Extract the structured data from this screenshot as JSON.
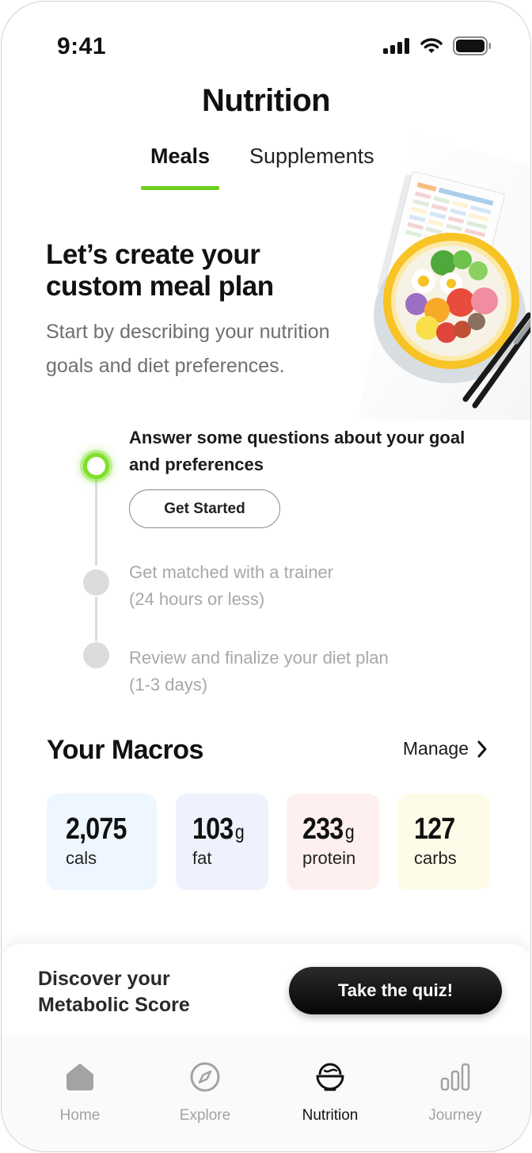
{
  "status_bar": {
    "time": "9:41"
  },
  "header": {
    "title": "Nutrition",
    "tabs": [
      {
        "label": "Meals",
        "active": true
      },
      {
        "label": "Supplements",
        "active": false
      }
    ]
  },
  "hero": {
    "title": "Let’s create your custom meal plan",
    "subtitle": "Start by describing your nutrition goals and diet preferences."
  },
  "steps": [
    {
      "text": "Answer some questions about your goal and preferences",
      "state": "active",
      "button_label": "Get Started"
    },
    {
      "text_line1": "Get matched with a trainer",
      "text_line2": "(24 hours or less)",
      "state": "pending"
    },
    {
      "text_line1": "Review and finalize your diet plan",
      "text_line2": "(1-3 days)",
      "state": "pending"
    }
  ],
  "macros": {
    "title": "Your Macros",
    "manage_label": "Manage",
    "items": [
      {
        "value": "2,075",
        "unit": "",
        "label": "cals",
        "color": "#eef6ff"
      },
      {
        "value": "103",
        "unit": "g",
        "label": "fat",
        "color": "#eef2fd"
      },
      {
        "value": "233",
        "unit": "g",
        "label": "protein",
        "color": "#fff0f0"
      },
      {
        "value": "127",
        "unit": "",
        "label": "carbs",
        "color": "#fefbe8"
      }
    ]
  },
  "quiz_banner": {
    "text": "Discover your Metabolic Score",
    "button_label": "Take the quiz!"
  },
  "bottom_nav": [
    {
      "label": "Home",
      "icon": "home-icon",
      "active": false
    },
    {
      "label": "Explore",
      "icon": "compass-icon",
      "active": false
    },
    {
      "label": "Nutrition",
      "icon": "bowl-icon",
      "active": true
    },
    {
      "label": "Journey",
      "icon": "bar-chart-icon",
      "active": false
    }
  ],
  "colors": {
    "accent": "#6bd01c",
    "active_dot_glow": "#7fe02a",
    "muted_text": "#a8a8a8"
  }
}
